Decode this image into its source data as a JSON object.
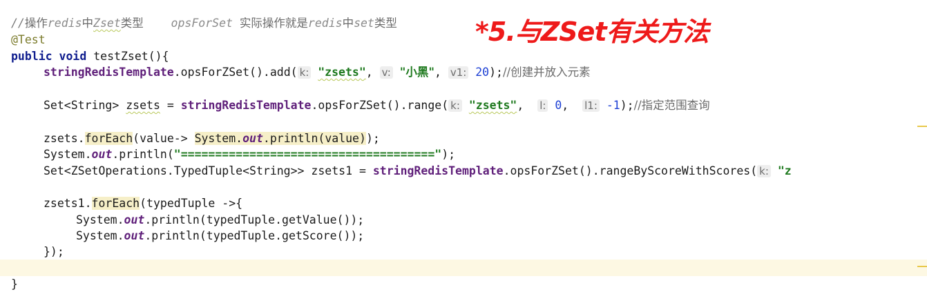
{
  "overlay_title": "*5.与ZSet有关方法",
  "code": {
    "comment": {
      "slash": "//",
      "p1": "操作",
      "redis1": "redis",
      "p2": "中",
      "zset": "Zset",
      "p3": "类型",
      "ops": "opsForSet",
      "p4": "实际操作就是",
      "redis2": "redis",
      "p5": "中",
      "set": "set",
      "p6": "类型"
    },
    "annotation": "@Test",
    "method_decl": {
      "public": "public",
      "void": "void",
      "rest": "testZset(){"
    },
    "line_add": {
      "field": "stringRedisTemplate",
      "call": ".opsForZSet().add(",
      "hint_k": "k:",
      "str1": "\"zsets\"",
      "sep1": ",",
      "hint_v": "v:",
      "str2": "\"小黑\"",
      "sep2": ",",
      "hint_v1": "v1:",
      "num": "20",
      "end": ");",
      "comment": "//创建并放入元素"
    },
    "line_range": {
      "decl1": "Set<String> ",
      "var": "zsets",
      "decl2": " = ",
      "field": "stringRedisTemplate",
      "call": ".opsForZSet().range(",
      "hint_k": "k:",
      "str": "\"zsets\"",
      "sep1": ",",
      "hint_l": "l:",
      "num1": "0",
      "sep2": ",",
      "hint_l1": "l1:",
      "num2": "-1",
      "end": ");",
      "comment": "//指定范围查询"
    },
    "line_foreach1": {
      "p1": "zsets.",
      "foreach": "forEach",
      "p2": "(value-> ",
      "sys": "System.",
      "out": "out",
      "p3": ".println(value)",
      "p4": ");"
    },
    "line_println": {
      "p1": "System.",
      "out": "out",
      "p2": ".println(",
      "str": "\"=====================================\"",
      "p3": ");"
    },
    "line_typed": {
      "p1": "Set<ZSetOperations.TypedTuple<String>> zsets1 = ",
      "field": "stringRedisTemplate",
      "call": ".opsForZSet().rangeByScoreWithScores(",
      "hint_k": "k:",
      "str": "\"z"
    },
    "line_foreach2": {
      "p1": "zsets1.",
      "foreach": "forEach",
      "p2": "(typedTuple ->{"
    },
    "line_get_value": {
      "p1": "System.",
      "out": "out",
      "p2": ".println(typedTuple.getValue());"
    },
    "line_get_score": {
      "p1": "System.",
      "out": "out",
      "p2": ".println(typedTuple.getScore());"
    },
    "line_close_lambda": "});",
    "line_close_method": "}"
  }
}
